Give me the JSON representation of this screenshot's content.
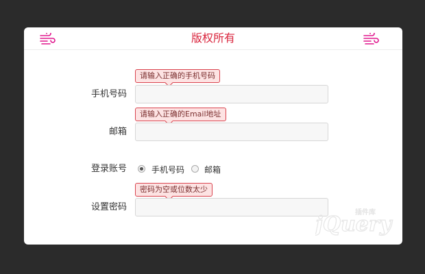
{
  "colors": {
    "background": "#2b2b2b",
    "title": "#d9243c",
    "icon": "#e0148c",
    "tip_border": "#d9434e",
    "tip_bg": "#fde3e3"
  },
  "header": {
    "title": "版权所有",
    "left_icon": "wind-icon",
    "right_icon": "wind-icon"
  },
  "form": {
    "phone": {
      "label": "手机号码",
      "value": "",
      "tip": "请输入正确的手机号码"
    },
    "email": {
      "label": "邮箱",
      "value": "",
      "tip": "请输入正确的Email地址"
    },
    "account": {
      "label": "登录账号",
      "options": [
        {
          "label": "手机号码",
          "checked": true
        },
        {
          "label": "邮箱",
          "checked": false
        }
      ]
    },
    "password": {
      "label": "设置密码",
      "value": "",
      "tip": "密码为空或位数太少"
    }
  },
  "watermark": {
    "brand": "jQuery",
    "sub": "插件库"
  }
}
